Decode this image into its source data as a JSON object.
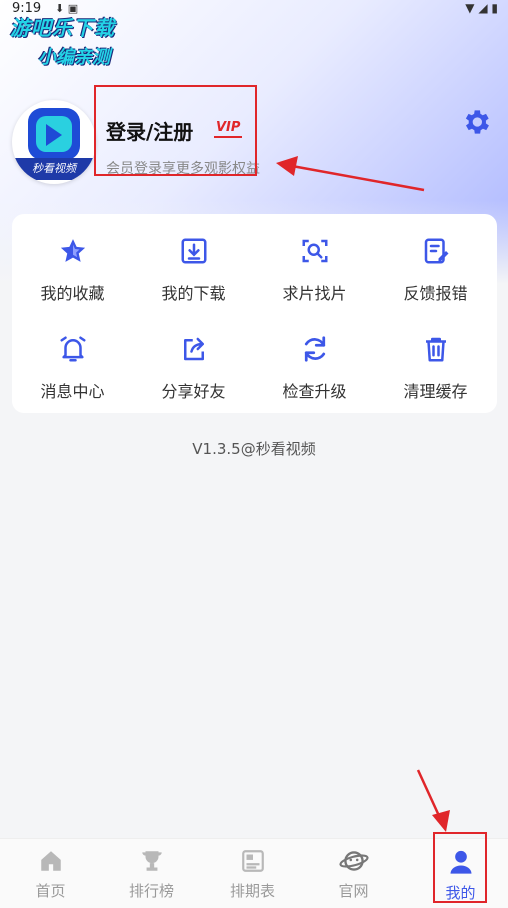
{
  "status_bar": {
    "time": "9:19"
  },
  "watermark": {
    "line1": "游吧乐下载",
    "line2": "小编亲测"
  },
  "profile": {
    "avatar_caption": "秒看视频",
    "login_label": "登录/注册",
    "vip_label": "VIP",
    "subtitle": "会员登录享更多观影权益"
  },
  "icons": {
    "settings": "gear-icon"
  },
  "accent_color": "#3d57e8",
  "menu": {
    "items": [
      {
        "label": "我的收藏",
        "icon": "star-icon"
      },
      {
        "label": "我的下载",
        "icon": "download-icon"
      },
      {
        "label": "求片找片",
        "icon": "scan-search-icon"
      },
      {
        "label": "反馈报错",
        "icon": "feedback-icon"
      },
      {
        "label": "消息中心",
        "icon": "bell-icon"
      },
      {
        "label": "分享好友",
        "icon": "share-icon"
      },
      {
        "label": "检查升级",
        "icon": "refresh-icon"
      },
      {
        "label": "清理缓存",
        "icon": "trash-icon"
      }
    ]
  },
  "version": "V1.3.5@秒看视频",
  "bottom_nav": {
    "items": [
      {
        "label": "首页",
        "icon": "home-icon"
      },
      {
        "label": "排行榜",
        "icon": "trophy-icon"
      },
      {
        "label": "排期表",
        "icon": "schedule-icon"
      },
      {
        "label": "官网",
        "icon": "planet-icon"
      },
      {
        "label": "我的",
        "icon": "user-icon",
        "active": true
      }
    ]
  }
}
